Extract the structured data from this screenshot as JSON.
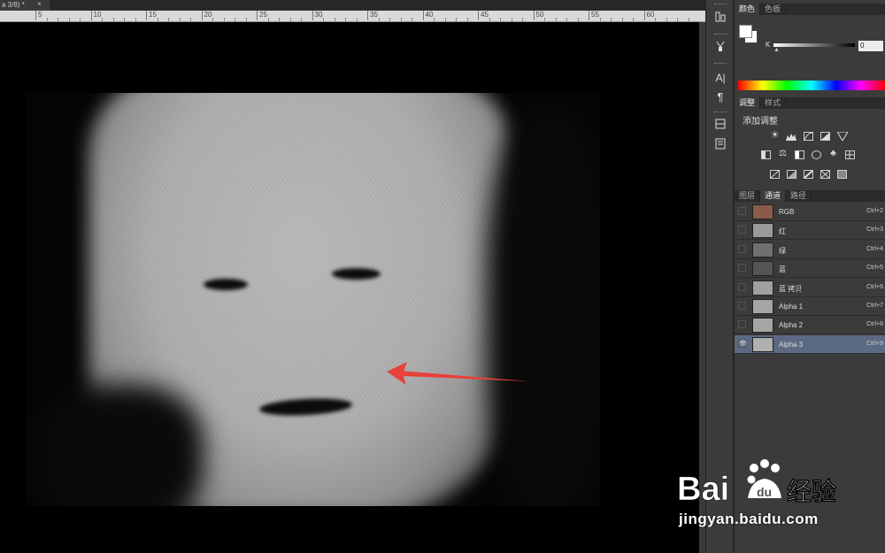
{
  "document": {
    "tab_title": "a 3/8) *",
    "tab_close": "×",
    "ruler_ticks": [
      "5",
      "10",
      "15",
      "20",
      "25",
      "30",
      "35",
      "40",
      "45",
      "50",
      "55",
      "60"
    ]
  },
  "tool_strip": {
    "icons": [
      "history-icon",
      "brush-preset-icon",
      "character-icon",
      "paragraph-icon",
      "layer-comps-icon",
      "notes-icon"
    ],
    "character_glyph": "A|",
    "paragraph_glyph": "¶"
  },
  "color_panel": {
    "tabs": [
      "颜色",
      "色板"
    ],
    "k_label": "K",
    "k_value": "0",
    "k_thumb": "▲"
  },
  "adjustments_panel": {
    "tabs": [
      "调整",
      "样式"
    ],
    "title": "添加调整"
  },
  "channels_panel": {
    "tabs": [
      "图层",
      "通道",
      "路径"
    ],
    "channels": [
      {
        "name": "RGB",
        "shortcut": "Ctrl+2",
        "visible": "",
        "thumb": "#8a5a4a"
      },
      {
        "name": "红",
        "shortcut": "Ctrl+3",
        "visible": "",
        "thumb": "#9a9a9a"
      },
      {
        "name": "绿",
        "shortcut": "Ctrl+4",
        "visible": "",
        "thumb": "#707070"
      },
      {
        "name": "蓝",
        "shortcut": "Ctrl+5",
        "visible": "",
        "thumb": "#555555"
      },
      {
        "name": "蓝 拷贝",
        "shortcut": "Ctrl+6",
        "visible": "",
        "thumb": "#a0a0a0"
      },
      {
        "name": "Alpha 1",
        "shortcut": "Ctrl+7",
        "visible": "",
        "thumb": "#a5a5a5"
      },
      {
        "name": "Alpha 2",
        "shortcut": "Ctrl+8",
        "visible": "",
        "thumb": "#a5a5a5"
      },
      {
        "name": "Alpha 3",
        "shortcut": "Ctrl+9",
        "visible": "👁",
        "thumb": "#b0b0b0"
      }
    ],
    "selected_index": 7
  },
  "watermark": {
    "brand": "Bai",
    "brand_suffix": "经验",
    "url": "jingyan.baidu.com"
  },
  "colors": {
    "panel_bg": "#3b3b3b",
    "selected_row": "#5b6a82",
    "arrow": "#e8413c"
  }
}
